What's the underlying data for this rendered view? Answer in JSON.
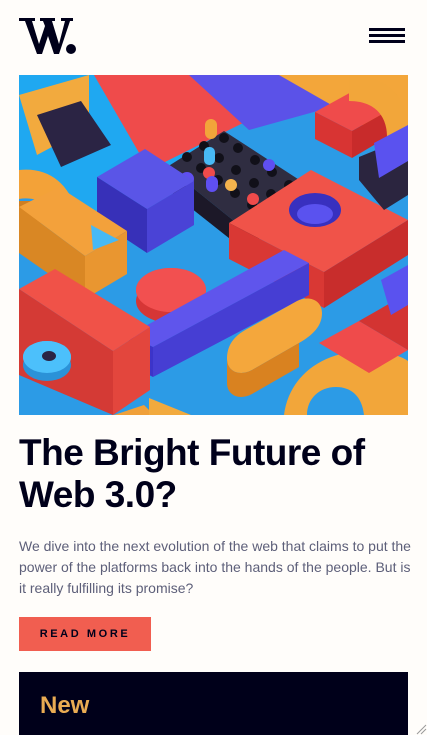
{
  "header": {
    "logo_text": "W.",
    "logo_icon": "w-logo-icon",
    "menu_icon": "hamburger-menu-icon"
  },
  "hero": {
    "image_icon": "abstract-3d-blocks-image"
  },
  "article": {
    "title": "The Bright Future of Web 3.0?",
    "intro": "We dive into the next evolution of the web that claims to put the power of the platforms back into the hands of the people. But is it really fulfilling its promise?",
    "read_more_label": "READ MORE"
  },
  "new_section": {
    "heading": "New"
  },
  "colors": {
    "background": "#fffdfa",
    "ink": "#00001a",
    "body_text": "#5d5f79",
    "accent_red": "#f15e50",
    "accent_orange": "#e9ab53"
  }
}
